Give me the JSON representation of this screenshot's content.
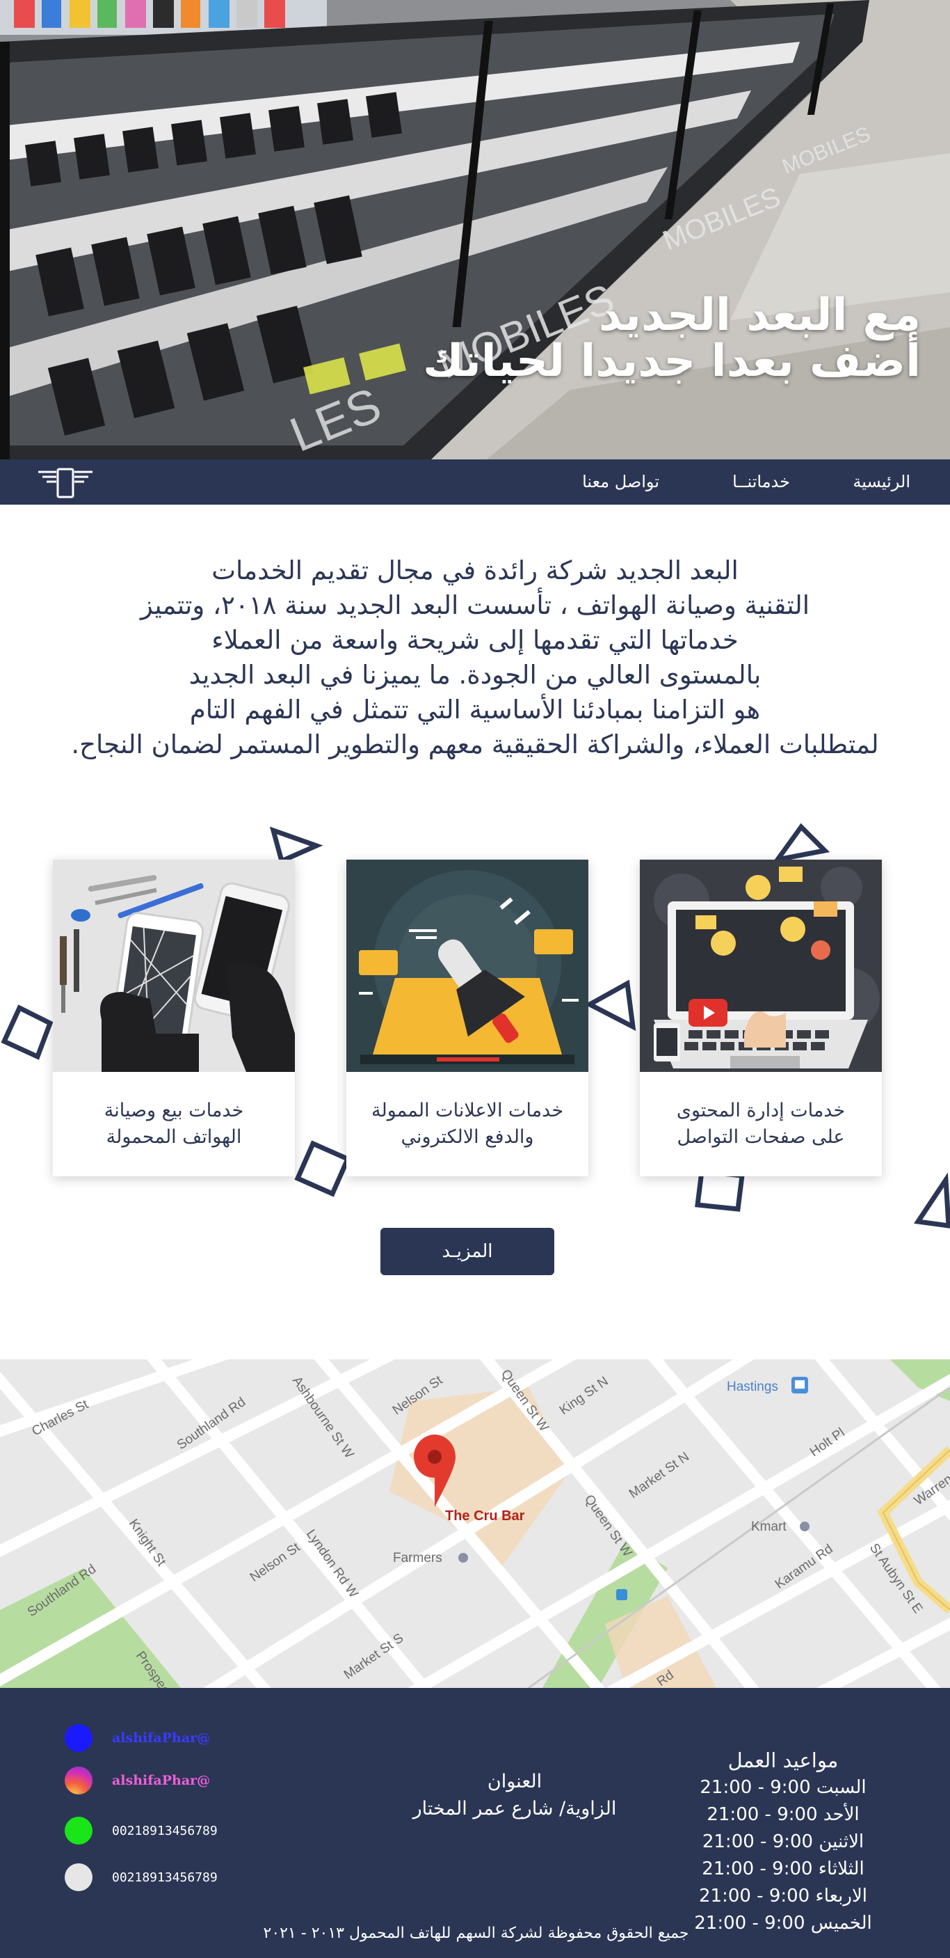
{
  "hero": {
    "line1": "مع البعد الجديد",
    "line2": "أضف بعدا جديدا لحياتك",
    "photo_text": "MOBILES"
  },
  "nav": {
    "items": [
      {
        "label": "الرئيسية"
      },
      {
        "label": "خدماتنــا"
      },
      {
        "label": "تواصل معنا"
      }
    ],
    "logo_icon": "phone-logo-icon"
  },
  "about": {
    "lines": [
      "البعد الجديد شركة رائدة في مجال تقديم الخدمات",
      "التقنية وصيانة الهواتف ، تأسست البعد الجديد سنة ٢٠١٨، وتتميز",
      "خدماتها التي تقدمها إلى شريحة واسعة من العملاء",
      "بالمستوى العالي من الجودة. ما يميزنا في البعد الجديد",
      "هو التزامنا بمبادئنا الأساسية التي تتمثل في الفهم التام",
      "لمتطلبات العملاء، والشراكة الحقيقية معهم والتطوير المستمر لضمان النجاح."
    ]
  },
  "services": {
    "cards": [
      {
        "line1": "خدمات إدارة المحتوى",
        "line2": "على صفحات التواصل"
      },
      {
        "line1": "خدمات الاعلانات الممولة",
        "line2": "والدفع الالكتروني"
      },
      {
        "line1": "خدمات بيع وصيانة",
        "line2": "الهواتف المحمولة"
      }
    ],
    "more_label": "المزيـد"
  },
  "map": {
    "pin_label": "The Cru Bar",
    "labels": [
      "Charles St",
      "Southland Rd",
      "Ashbourne St W",
      "Nelson St",
      "Queen St W",
      "King St N",
      "Hastings",
      "Holt Pl",
      "Market St N",
      "Queen St W",
      "Nelson St",
      "Lyndon Rd W",
      "Farmers",
      "Kmart",
      "Karamu Rd",
      "St Aubyn St E",
      "Southland Rd",
      "Knight St",
      "Prospect",
      "Market St S",
      "Warren",
      "Rd"
    ]
  },
  "footer": {
    "hours_title": "مواعيد العمل",
    "hours": [
      "السبت 9:00 - 21:00",
      "الأحد 9:00 - 21:00",
      "الاثنين 9:00 - 21:00",
      "الثلاثاء 9:00 - 21:00",
      "الاربعاء 9:00 - 21:00",
      "الخميس 9:00 - 21:00"
    ],
    "address_title": "العنوان",
    "address": "الزاوية/ شارع عمر المختار",
    "contacts": [
      {
        "text": "alshifaPhar@",
        "color": "#1a1aff",
        "text_color": "#3a3aff"
      },
      {
        "text": "alshifaPhar@",
        "color": "#e83ad8",
        "text_color": "#ef5fd8"
      },
      {
        "text": "00218913456789",
        "color": "#19e519",
        "text_color": "#ffffff"
      },
      {
        "text": "00218913456789",
        "color": "#e6e6e6",
        "text_color": "#ffffff"
      }
    ],
    "copyright": "جميع الحقوق محفوظة لشركة السهم للهاتف المحمول ٢٠١٣ - ٢٠٢١"
  },
  "colors": {
    "navy": "#2b3655",
    "white": "#ffffff",
    "map_bg": "#e8e8e8"
  }
}
